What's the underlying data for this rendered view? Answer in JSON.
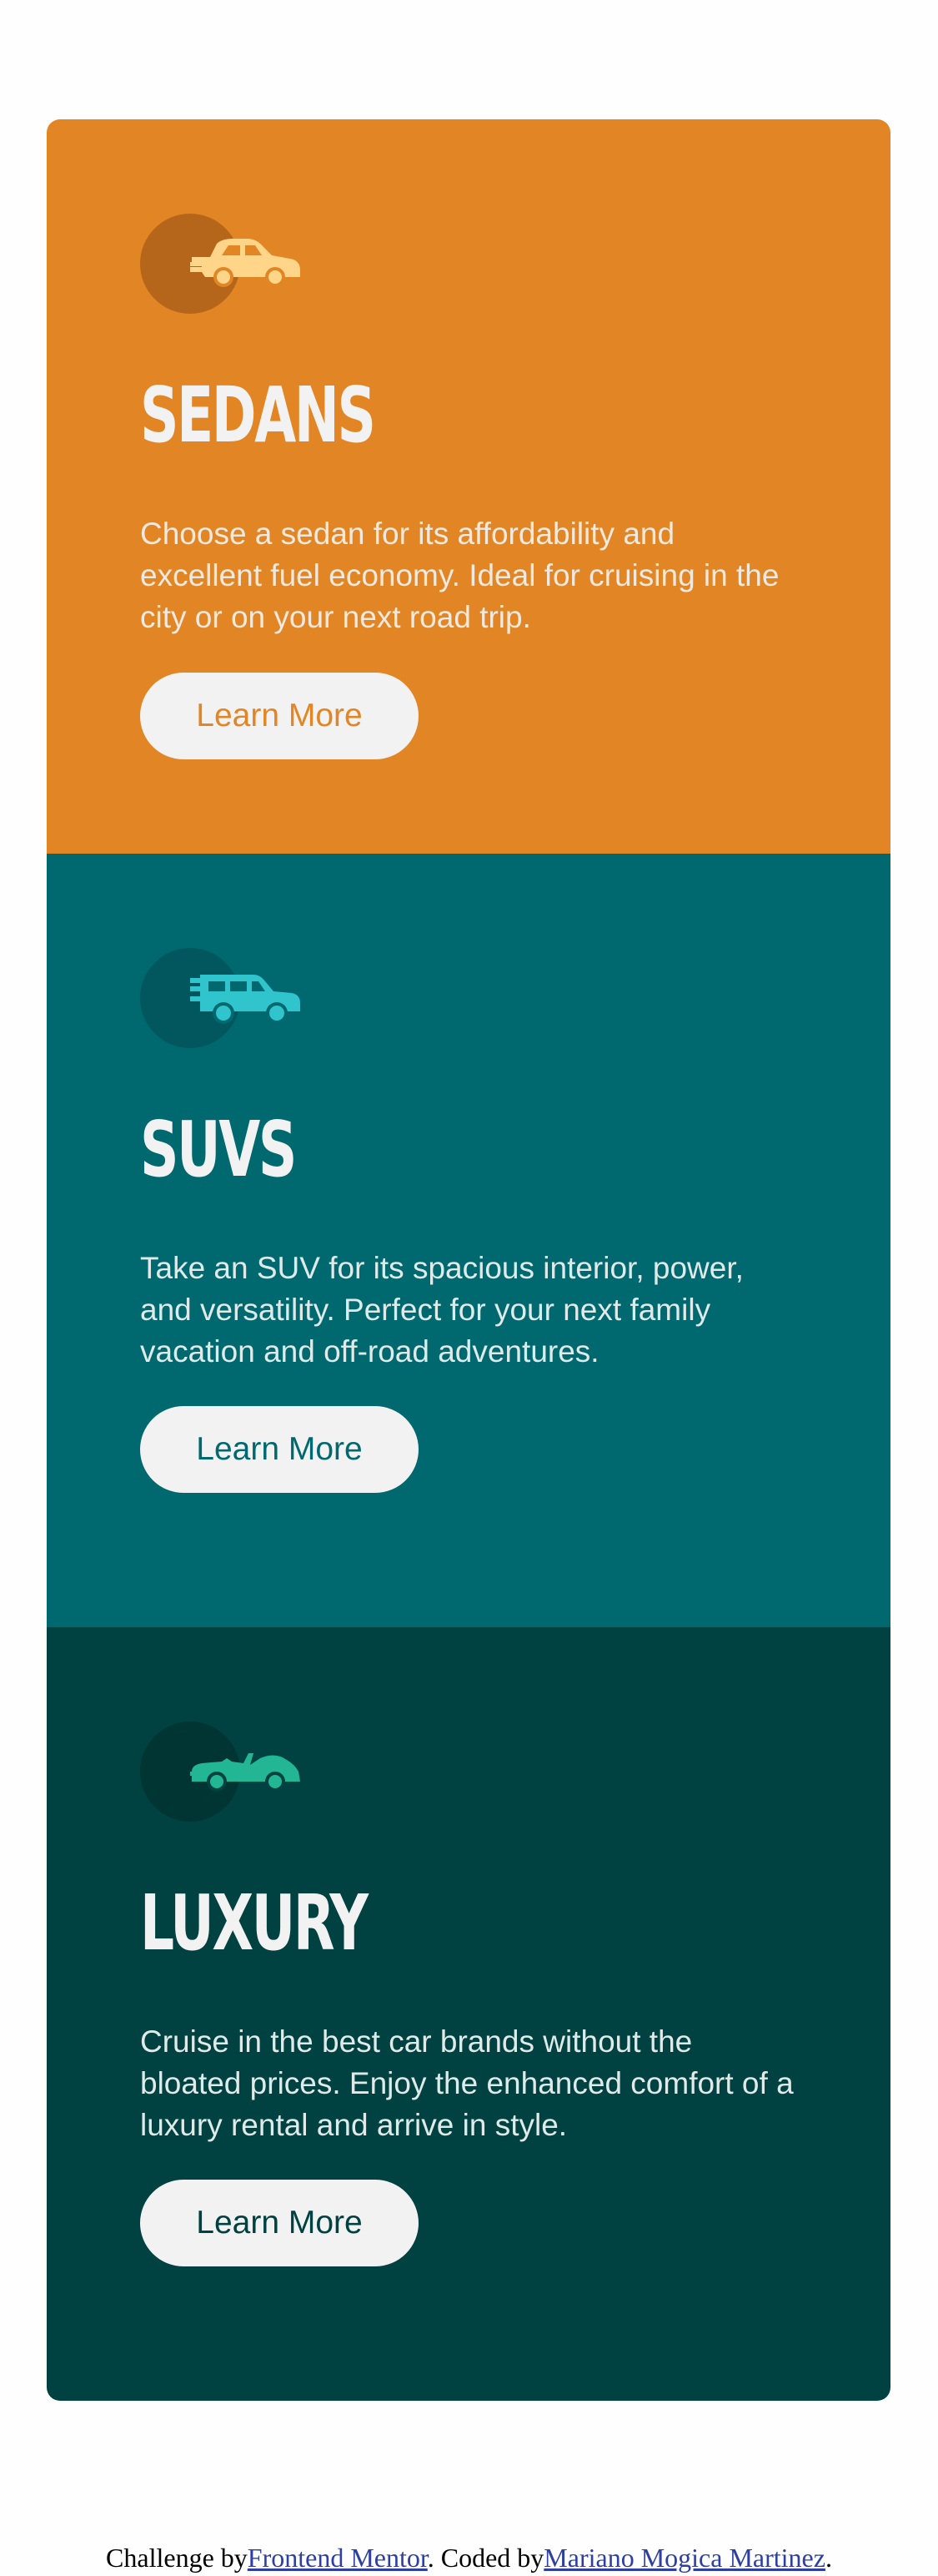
{
  "cards": [
    {
      "icon": "sedan-car-icon",
      "title": "SEDANS",
      "description": "Choose a sedan for its affordability and excellent fuel economy. Ideal for cruising in the city or on your next road trip.",
      "button_label": "Learn More",
      "color": "#e28625"
    },
    {
      "icon": "suv-car-icon",
      "title": "SUVS",
      "description": "Take an SUV for its spacious interior, power, and versatility. Perfect for your next family vacation and off-road adventures.",
      "button_label": "Learn More",
      "color": "#006970"
    },
    {
      "icon": "luxury-car-icon",
      "title": "LUXURY",
      "description": "Cruise in the best car brands without the bloated prices. Enjoy the enhanced comfort of a luxury rental and arrive in style.",
      "button_label": "Learn More",
      "color": "#004241"
    }
  ],
  "attribution": {
    "prefix": "Challenge by",
    "challenge_link": "Frontend Mentor",
    "middle": ". Coded by",
    "author_link": "Mariano Mogica Martinez",
    "suffix": "."
  },
  "colors": {
    "icon_sedan": "#ffd58a",
    "icon_suv": "#30c4cc",
    "icon_luxury": "#22b694",
    "button_bg": "#f2f2f2"
  }
}
